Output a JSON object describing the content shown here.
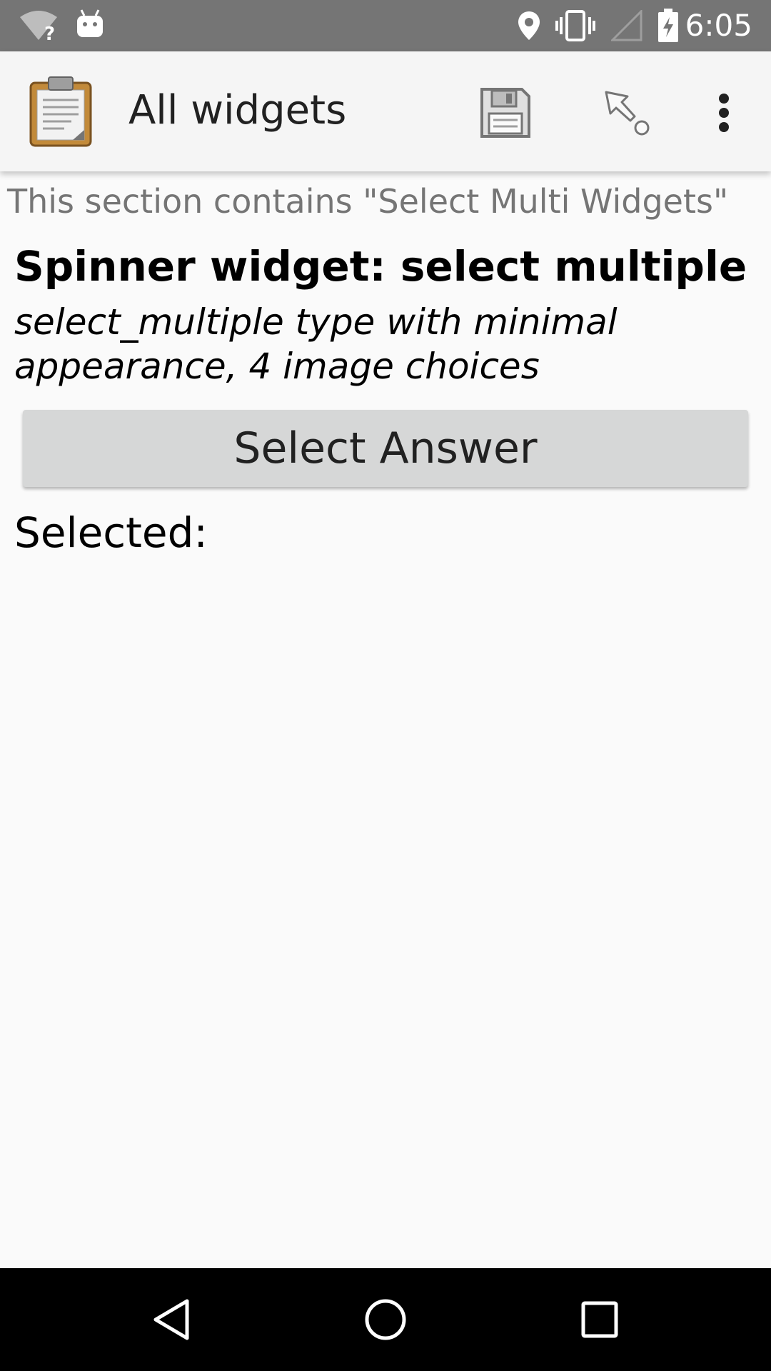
{
  "status_bar": {
    "time": "6:05",
    "icons": [
      "wifi-unknown-icon",
      "android-debug-icon",
      "location-icon",
      "vibrate-icon",
      "signal-icon",
      "battery-charging-icon"
    ]
  },
  "app_bar": {
    "title": "All widgets",
    "icon": "clipboard-icon",
    "actions": [
      "save-icon",
      "jump-to-icon",
      "more-options-icon"
    ]
  },
  "content": {
    "section_text": "This section contains \"Select Multi Widgets\"",
    "question_label": "Spinner widget: select multiple",
    "question_hint": "select_multiple type with minimal appearance, 4 image choices",
    "select_button_label": "Select Answer",
    "selected_label": "Selected:"
  },
  "nav_bar": {
    "buttons": [
      "back-icon",
      "home-icon",
      "recents-icon"
    ]
  },
  "colors": {
    "status_bar": "#757575",
    "app_bar": "#f5f5f5",
    "background": "#fafafa",
    "button": "#d6d7d7",
    "nav_bar": "#000000"
  }
}
